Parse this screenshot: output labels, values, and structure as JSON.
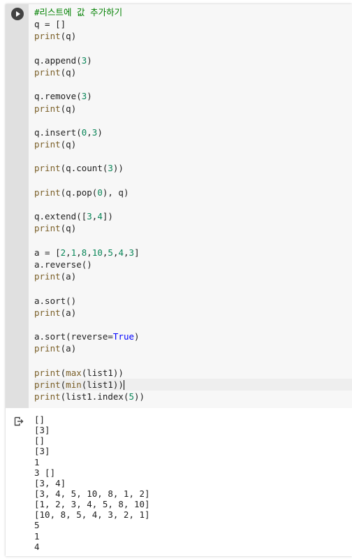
{
  "cell": {
    "run_button_icon": "play-icon",
    "output_icon": "output-arrow-icon"
  },
  "code_lines": [
    [
      {
        "t": "#리스트에 값 추가하기",
        "c": "comment"
      }
    ],
    [
      {
        "t": "q = []",
        "c": ""
      }
    ],
    [
      {
        "t": "print",
        "c": "fn"
      },
      {
        "t": "(q)",
        "c": ""
      }
    ],
    [],
    [
      {
        "t": "q.append(",
        "c": ""
      },
      {
        "t": "3",
        "c": "num"
      },
      {
        "t": ")",
        "c": ""
      }
    ],
    [
      {
        "t": "print",
        "c": "fn"
      },
      {
        "t": "(q)",
        "c": ""
      }
    ],
    [],
    [
      {
        "t": "q.remove(",
        "c": ""
      },
      {
        "t": "3",
        "c": "num"
      },
      {
        "t": ")",
        "c": ""
      }
    ],
    [
      {
        "t": "print",
        "c": "fn"
      },
      {
        "t": "(q)",
        "c": ""
      }
    ],
    [],
    [
      {
        "t": "q.insert(",
        "c": ""
      },
      {
        "t": "0",
        "c": "num"
      },
      {
        "t": ",",
        "c": ""
      },
      {
        "t": "3",
        "c": "num"
      },
      {
        "t": ")",
        "c": ""
      }
    ],
    [
      {
        "t": "print",
        "c": "fn"
      },
      {
        "t": "(q)",
        "c": ""
      }
    ],
    [],
    [
      {
        "t": "print",
        "c": "fn"
      },
      {
        "t": "(q.count(",
        "c": ""
      },
      {
        "t": "3",
        "c": "num"
      },
      {
        "t": "))",
        "c": ""
      }
    ],
    [],
    [
      {
        "t": "print",
        "c": "fn"
      },
      {
        "t": "(q.pop(",
        "c": ""
      },
      {
        "t": "0",
        "c": "num"
      },
      {
        "t": "), q)",
        "c": ""
      }
    ],
    [],
    [
      {
        "t": "q.extend([",
        "c": ""
      },
      {
        "t": "3",
        "c": "num"
      },
      {
        "t": ",",
        "c": ""
      },
      {
        "t": "4",
        "c": "num"
      },
      {
        "t": "])",
        "c": ""
      }
    ],
    [
      {
        "t": "print",
        "c": "fn"
      },
      {
        "t": "(q)",
        "c": ""
      }
    ],
    [],
    [
      {
        "t": "a = [",
        "c": ""
      },
      {
        "t": "2",
        "c": "num"
      },
      {
        "t": ",",
        "c": ""
      },
      {
        "t": "1",
        "c": "num"
      },
      {
        "t": ",",
        "c": ""
      },
      {
        "t": "8",
        "c": "num"
      },
      {
        "t": ",",
        "c": ""
      },
      {
        "t": "10",
        "c": "num"
      },
      {
        "t": ",",
        "c": ""
      },
      {
        "t": "5",
        "c": "num"
      },
      {
        "t": ",",
        "c": ""
      },
      {
        "t": "4",
        "c": "num"
      },
      {
        "t": ",",
        "c": ""
      },
      {
        "t": "3",
        "c": "num"
      },
      {
        "t": "]",
        "c": ""
      }
    ],
    [
      {
        "t": "a.reverse()",
        "c": ""
      }
    ],
    [
      {
        "t": "print",
        "c": "fn"
      },
      {
        "t": "(a)",
        "c": ""
      }
    ],
    [],
    [
      {
        "t": "a.sort()",
        "c": ""
      }
    ],
    [
      {
        "t": "print",
        "c": "fn"
      },
      {
        "t": "(a)",
        "c": ""
      }
    ],
    [],
    [
      {
        "t": "a.sort(reverse=",
        "c": ""
      },
      {
        "t": "True",
        "c": "const"
      },
      {
        "t": ")",
        "c": ""
      }
    ],
    [
      {
        "t": "print",
        "c": "fn"
      },
      {
        "t": "(a)",
        "c": ""
      }
    ],
    [],
    [
      {
        "t": "print",
        "c": "fn"
      },
      {
        "t": "(",
        "c": ""
      },
      {
        "t": "max",
        "c": "fn"
      },
      {
        "t": "(list1))",
        "c": ""
      }
    ],
    [
      {
        "t": "print",
        "c": "fn"
      },
      {
        "t": "(",
        "c": ""
      },
      {
        "t": "min",
        "c": "fn"
      },
      {
        "t": "(list1))",
        "c": ""
      },
      {
        "t": "|",
        "c": "cursor"
      }
    ],
    [
      {
        "t": "print",
        "c": "fn"
      },
      {
        "t": "(list1.index(",
        "c": ""
      },
      {
        "t": "5",
        "c": "num"
      },
      {
        "t": "))",
        "c": ""
      }
    ]
  ],
  "current_line_index": 31,
  "output_lines": [
    "[]",
    "[3]",
    "[]",
    "[3]",
    "1",
    "3 []",
    "[3, 4]",
    "[3, 4, 5, 10, 8, 1, 2]",
    "[1, 2, 3, 4, 5, 8, 10]",
    "[10, 8, 5, 4, 3, 2, 1]",
    "5",
    "1",
    "4"
  ]
}
